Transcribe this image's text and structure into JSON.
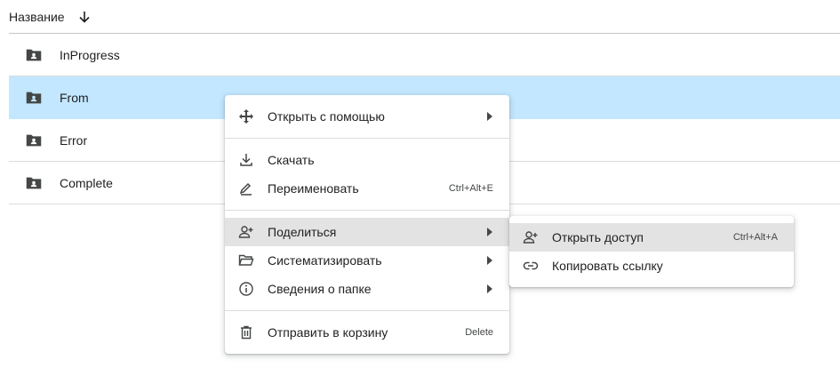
{
  "header": {
    "title": "Название",
    "sort_icon": "arrow-down-icon"
  },
  "rows": [
    {
      "label": "InProgress",
      "icon": "shared-folder-icon",
      "selected": false
    },
    {
      "label": "From",
      "icon": "shared-folder-icon",
      "selected": true
    },
    {
      "label": "Error",
      "icon": "shared-folder-icon",
      "selected": false
    },
    {
      "label": "Complete",
      "icon": "shared-folder-icon",
      "selected": false
    }
  ],
  "context_menu": {
    "open_with": {
      "label": "Открыть с помощью",
      "icon": "move-arrows-icon"
    },
    "download": {
      "label": "Скачать",
      "icon": "download-icon"
    },
    "rename": {
      "label": "Переименовать",
      "shortcut": "Ctrl+Alt+E",
      "icon": "pen-icon"
    },
    "share": {
      "label": "Поделиться",
      "icon": "person-add-icon"
    },
    "organize": {
      "label": "Систематизировать",
      "icon": "folder-open-icon"
    },
    "info": {
      "label": "Сведения о папке",
      "icon": "info-icon"
    },
    "trash": {
      "label": "Отправить в корзину",
      "shortcut": "Delete",
      "icon": "trash-icon"
    }
  },
  "share_submenu": {
    "share_access": {
      "label": "Открыть доступ",
      "shortcut": "Ctrl+Alt+A",
      "icon": "person-add-icon"
    },
    "copy_link": {
      "label": "Копировать ссылку",
      "icon": "link-icon"
    }
  },
  "colors": {
    "selected_row": "#c2e7ff",
    "hover_item": "#e3e3e3",
    "icon": "#444746",
    "text": "#1f1f1f"
  }
}
